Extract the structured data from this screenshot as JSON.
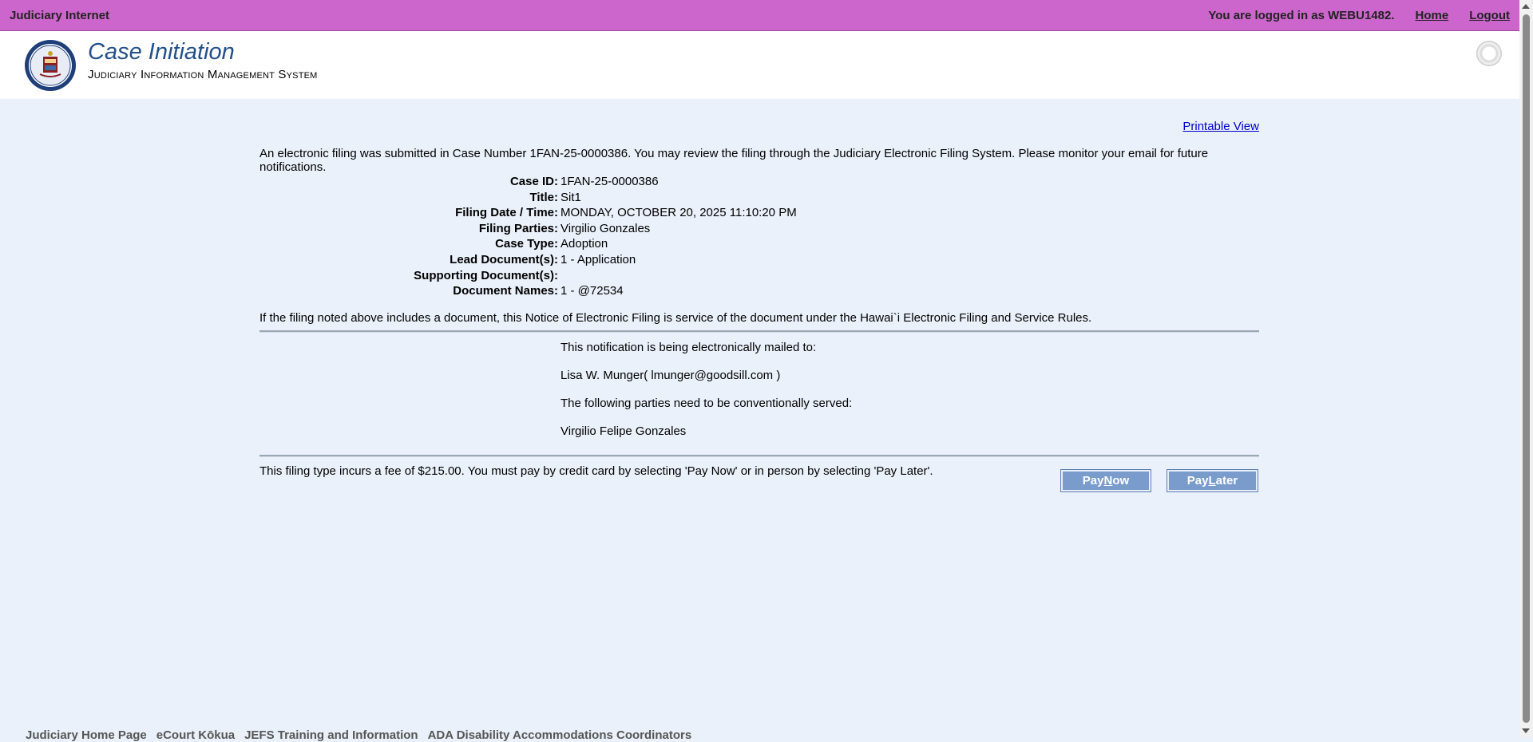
{
  "topbar": {
    "brand": "Judiciary Internet",
    "logged_in": "You are logged in as WEBU1482.",
    "home_link": "Home",
    "logout_link": "Logout"
  },
  "header": {
    "title": "Case Initiation",
    "subtitle": "Judiciary Information Management System"
  },
  "content": {
    "printable_view": "Printable View",
    "intro": "An electronic filing was submitted in Case Number 1FAN-25-0000386. You may review the filing through the Judiciary Electronic Filing System. Please monitor your email for future notifications.",
    "details": [
      {
        "label": "Case ID:",
        "value": "1FAN-25-0000386"
      },
      {
        "label": "Title:",
        "value": "Sit1"
      },
      {
        "label": "Filing Date / Time:",
        "value": "MONDAY, OCTOBER 20, 2025 11:10:20 PM"
      },
      {
        "label": "Filing Parties:",
        "value": "Virgilio Gonzales"
      },
      {
        "label": "Case Type:",
        "value": "Adoption"
      },
      {
        "label": "Lead Document(s):",
        "value": "1 - Application"
      },
      {
        "label": "Supporting Document(s):",
        "value": ""
      },
      {
        "label": "Document Names:",
        "value": "1 - @72534"
      }
    ],
    "service_note": "If the filing noted above includes a document, this Notice of Electronic Filing is service of the document under the Hawai`i Electronic Filing and Service Rules.",
    "mail_intro": "This notification is being electronically mailed to:",
    "mail_recipient": "Lisa W. Munger( lmunger@goodsill.com )",
    "conventional_intro": "The following parties need to be conventionally served:",
    "conventional_party": "Virgilio Felipe Gonzales",
    "fee_text": "This filing type incurs a fee of $215.00. You must pay by credit card by selecting 'Pay Now' or in person by selecting 'Pay Later'.",
    "pay_now": {
      "pre": "Pay ",
      "key": "N",
      "post": "ow"
    },
    "pay_later": {
      "pre": "Pay ",
      "key": "L",
      "post": "ater"
    }
  },
  "footer": {
    "links": [
      "Judiciary Home Page",
      "eCourt Kōkua",
      "JEFS Training and Information",
      "ADA Disability Accommodations Coordinators"
    ]
  }
}
